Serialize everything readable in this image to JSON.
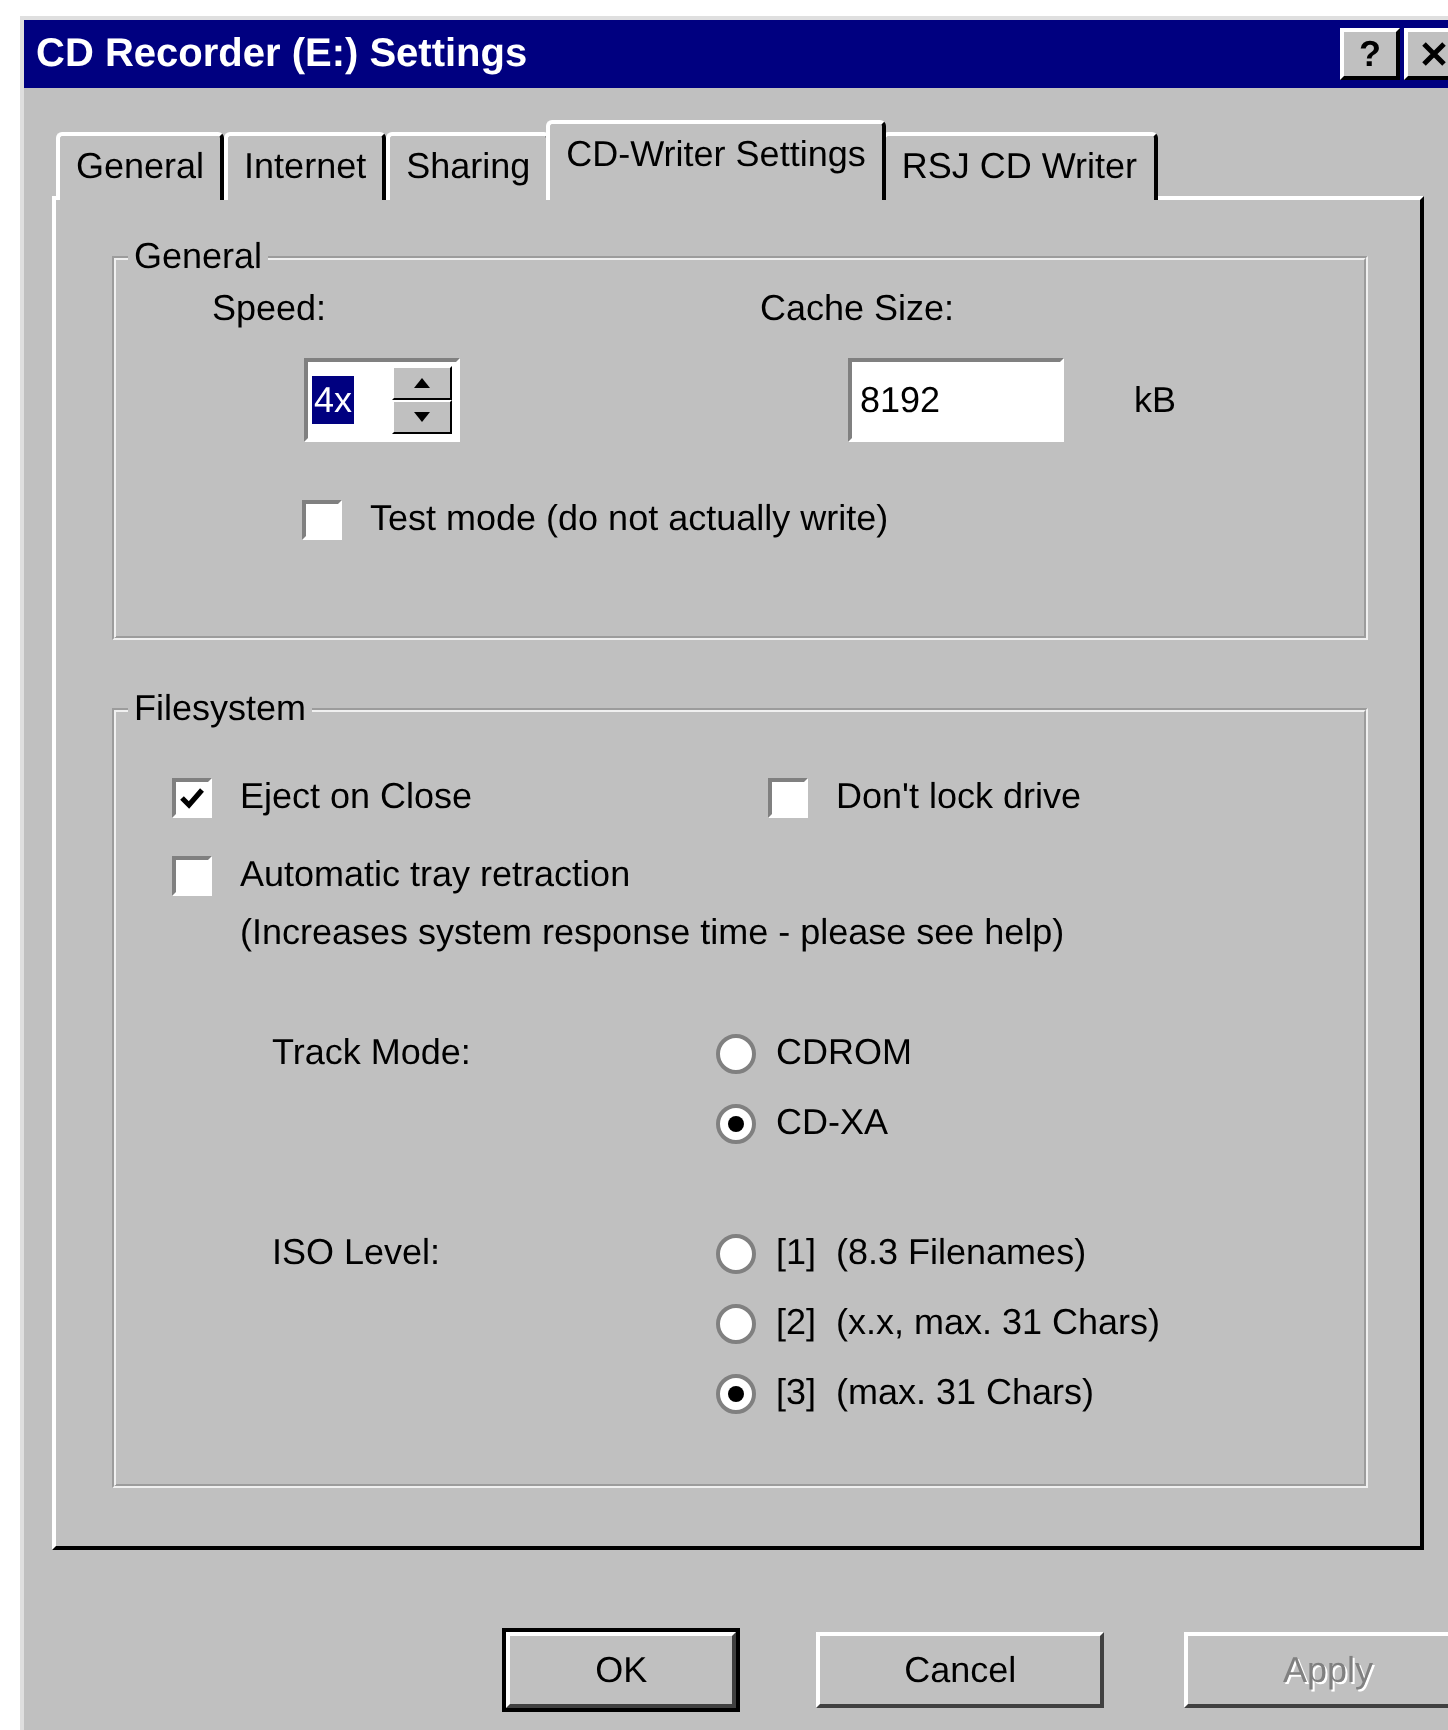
{
  "window": {
    "title": "CD Recorder (E:) Settings",
    "help_button": "?"
  },
  "tabs": [
    {
      "label": "General",
      "selected": false
    },
    {
      "label": "Internet",
      "selected": false
    },
    {
      "label": "Sharing",
      "selected": false
    },
    {
      "label": "CD-Writer Settings",
      "selected": true
    },
    {
      "label": "RSJ CD Writer",
      "selected": false
    }
  ],
  "general": {
    "title": "General",
    "speed": {
      "label": "Speed:",
      "value": "4x",
      "value_selected": true
    },
    "cache": {
      "label": "Cache Size:",
      "value": "8192",
      "unit": "kB"
    },
    "test_mode": {
      "label": "Test mode (do not actually write)",
      "checked": false
    }
  },
  "filesystem": {
    "title": "Filesystem",
    "eject_on_close": {
      "label": "Eject on Close",
      "checked": true
    },
    "dont_lock_drive": {
      "label": "Don't lock drive",
      "checked": false
    },
    "automatic_tray_retraction": {
      "label": "Automatic tray retraction",
      "note": "(Increases system response time - please see help)",
      "checked": false
    },
    "track_mode": {
      "label": "Track Mode:",
      "options": [
        {
          "label": "CDROM",
          "selected": false
        },
        {
          "label": "CD-XA",
          "selected": true
        }
      ]
    },
    "iso_level": {
      "label": "ISO Level:",
      "options": [
        {
          "label": "[1]  (8.3 Filenames)",
          "selected": false
        },
        {
          "label": "[2]  (x.x, max. 31 Chars)",
          "selected": false
        },
        {
          "label": "[3]  (max. 31 Chars)",
          "selected": true
        }
      ]
    }
  },
  "buttons": [
    {
      "label": "OK",
      "disabled": false,
      "default": true
    },
    {
      "label": "Cancel",
      "disabled": false,
      "default": false
    },
    {
      "label": "Apply",
      "disabled": true,
      "default": false
    }
  ]
}
